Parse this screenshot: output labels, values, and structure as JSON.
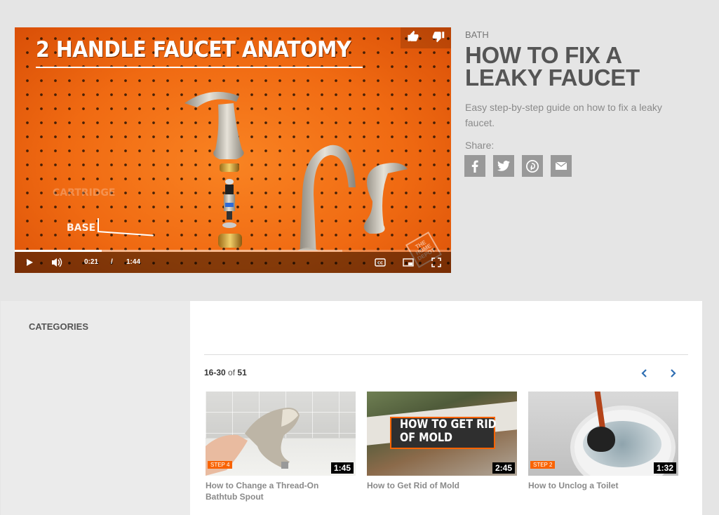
{
  "video": {
    "overlay_title": "2 HANDLE FAUCET ANATOMY",
    "part_label_base": "BASE",
    "part_label_faint": "CARTRIDGE",
    "watermark": "THE HOME DEPOT",
    "current_time": "0:21",
    "separator": "/",
    "duration": "1:44",
    "progress_fraction": 0.2,
    "buffered_fraction": 0.75,
    "icons": {
      "like": "thumbs-up-icon",
      "dislike": "thumbs-down-icon",
      "play": "play-icon",
      "volume": "volume-icon",
      "captions": "closed-captions-icon",
      "pip": "picture-in-picture-icon",
      "fullscreen": "fullscreen-icon"
    }
  },
  "article": {
    "category": "BATH",
    "title": "HOW TO FIX A LEAKY FAUCET",
    "description": "Easy step-by-step guide on how to fix a leaky faucet.",
    "share_label": "Share:",
    "share_buttons": [
      "facebook-icon",
      "twitter-icon",
      "pinterest-icon",
      "email-icon"
    ]
  },
  "sidebar": {
    "title": "CATEGORIES"
  },
  "results": {
    "range": "16-30",
    "of": "of",
    "total": "51",
    "cards": [
      {
        "title": "How to Change a Thread-On Bathtub Spout",
        "duration": "1:45",
        "step": "STEP 4"
      },
      {
        "title": "How to Get Rid of Mold",
        "duration": "2:45",
        "step": "",
        "thumb_text": "HOW TO GET RID OF MOLD"
      },
      {
        "title": "How to Unclog a Toilet",
        "duration": "1:32",
        "step": "STEP 2"
      }
    ]
  },
  "colors": {
    "brand_orange": "#f96302",
    "link_blue": "#2f6fb3",
    "share_gray": "#999999"
  }
}
